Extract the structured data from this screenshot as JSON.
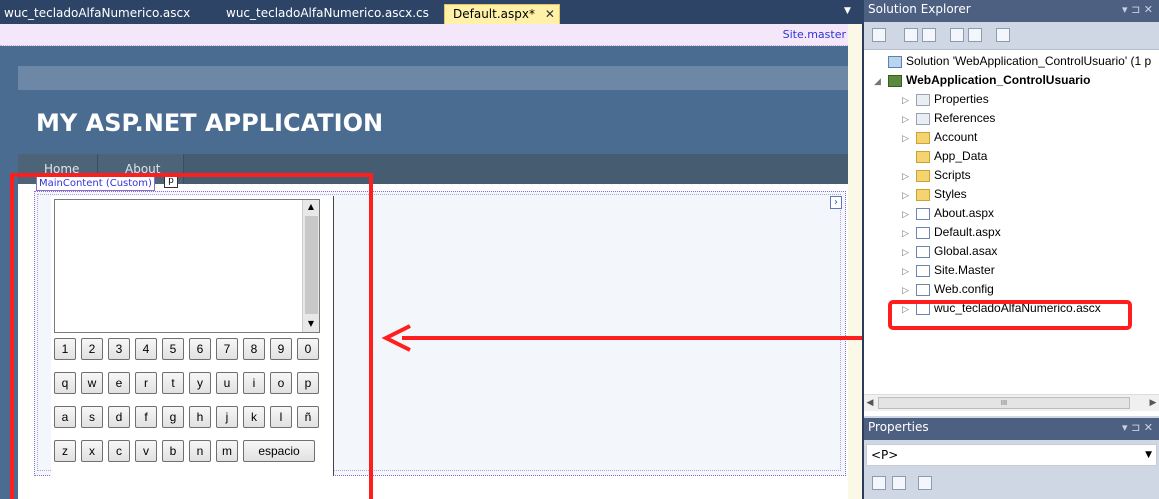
{
  "tabs": [
    {
      "label": "wuc_tecladoAlfaNumerico.ascx"
    },
    {
      "label": "wuc_tecladoAlfaNumerico.ascx.cs"
    },
    {
      "label": "Default.aspx*",
      "active": true
    }
  ],
  "tab_close_glyph": "✕",
  "tab_dropdown_glyph": "▼",
  "designer": {
    "master_label": "Site.master",
    "app_title": "MY ASP.NET APPLICATION",
    "menu": [
      "Home",
      "About"
    ],
    "content_label": "MainContent (Custom)",
    "p_tag": "p",
    "chevron": "›"
  },
  "keyboard": {
    "row1": [
      "1",
      "2",
      "3",
      "4",
      "5",
      "6",
      "7",
      "8",
      "9",
      "0"
    ],
    "row2": [
      "q",
      "w",
      "e",
      "r",
      "t",
      "y",
      "u",
      "i",
      "o",
      "p"
    ],
    "row3": [
      "a",
      "s",
      "d",
      "f",
      "g",
      "h",
      "j",
      "k",
      "l",
      "ñ"
    ],
    "row4": [
      "z",
      "x",
      "c",
      "v",
      "b",
      "n",
      "m",
      "espacio"
    ]
  },
  "solution_explorer": {
    "title": "Solution Explorer",
    "controls": "▾ ⊐ ✕",
    "items": [
      {
        "label": "Solution 'WebApplication_ControlUsuario' (1 p",
        "icon": "solution-icon",
        "level": 0,
        "exp": ""
      },
      {
        "label": "WebApplication_ControlUsuario",
        "icon": "project-icon",
        "level": 0,
        "exp": "◢",
        "bold": true
      },
      {
        "label": "Properties",
        "icon": "properties-icon",
        "level": 1,
        "exp": "▷"
      },
      {
        "label": "References",
        "icon": "references-icon",
        "level": 1,
        "exp": "▷"
      },
      {
        "label": "Account",
        "icon": "folder-icon",
        "level": 1,
        "exp": "▷"
      },
      {
        "label": "App_Data",
        "icon": "folder-icon",
        "level": 1,
        "exp": ""
      },
      {
        "label": "Scripts",
        "icon": "folder-icon",
        "level": 1,
        "exp": "▷"
      },
      {
        "label": "Styles",
        "icon": "folder-icon",
        "level": 1,
        "exp": "▷"
      },
      {
        "label": "About.aspx",
        "icon": "aspx-file-icon",
        "level": 1,
        "exp": "▷"
      },
      {
        "label": "Default.aspx",
        "icon": "aspx-file-icon",
        "level": 1,
        "exp": "▷"
      },
      {
        "label": "Global.asax",
        "icon": "asax-file-icon",
        "level": 1,
        "exp": "▷"
      },
      {
        "label": "Site.Master",
        "icon": "master-file-icon",
        "level": 1,
        "exp": "▷"
      },
      {
        "label": "Web.config",
        "icon": "config-file-icon",
        "level": 1,
        "exp": "▷"
      },
      {
        "label": "wuc_tecladoAlfaNumerico.ascx",
        "icon": "ascx-file-icon",
        "level": 1,
        "exp": "▷"
      }
    ],
    "hscroll_thumb": "III"
  },
  "properties": {
    "title": "Properties",
    "controls": "▾ ⊐ ✕",
    "selected": "<P>"
  },
  "colors": {
    "annotation_red": "#ff1e1e",
    "active_tab": "#fff1a8",
    "header_blue": "#4b6c91"
  }
}
